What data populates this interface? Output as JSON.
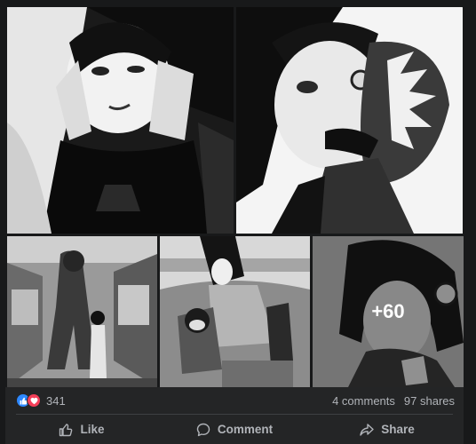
{
  "post": {
    "photos": [
      {
        "alt": "ink drawing of girl with hands on face"
      },
      {
        "alt": "ink drawing of girl with monstrous fanged growth"
      },
      {
        "alt": "drawing of creature in subway car"
      },
      {
        "alt": "drawing of schoolgirl and figure in alley"
      },
      {
        "alt": "drawing of dark-haired figure",
        "more_label": "+60"
      }
    ],
    "reactions": {
      "icons": [
        "like-icon",
        "love-icon"
      ],
      "count": "341"
    },
    "comments_label": "4 comments",
    "shares_label": "97 shares"
  },
  "actions": {
    "like_label": "Like",
    "comment_label": "Comment",
    "share_label": "Share"
  },
  "colors": {
    "background": "#18191a",
    "card": "#242526",
    "text_secondary": "#b0b3b8",
    "like_blue": "#2d88ff",
    "love_red": "#f33e58"
  }
}
